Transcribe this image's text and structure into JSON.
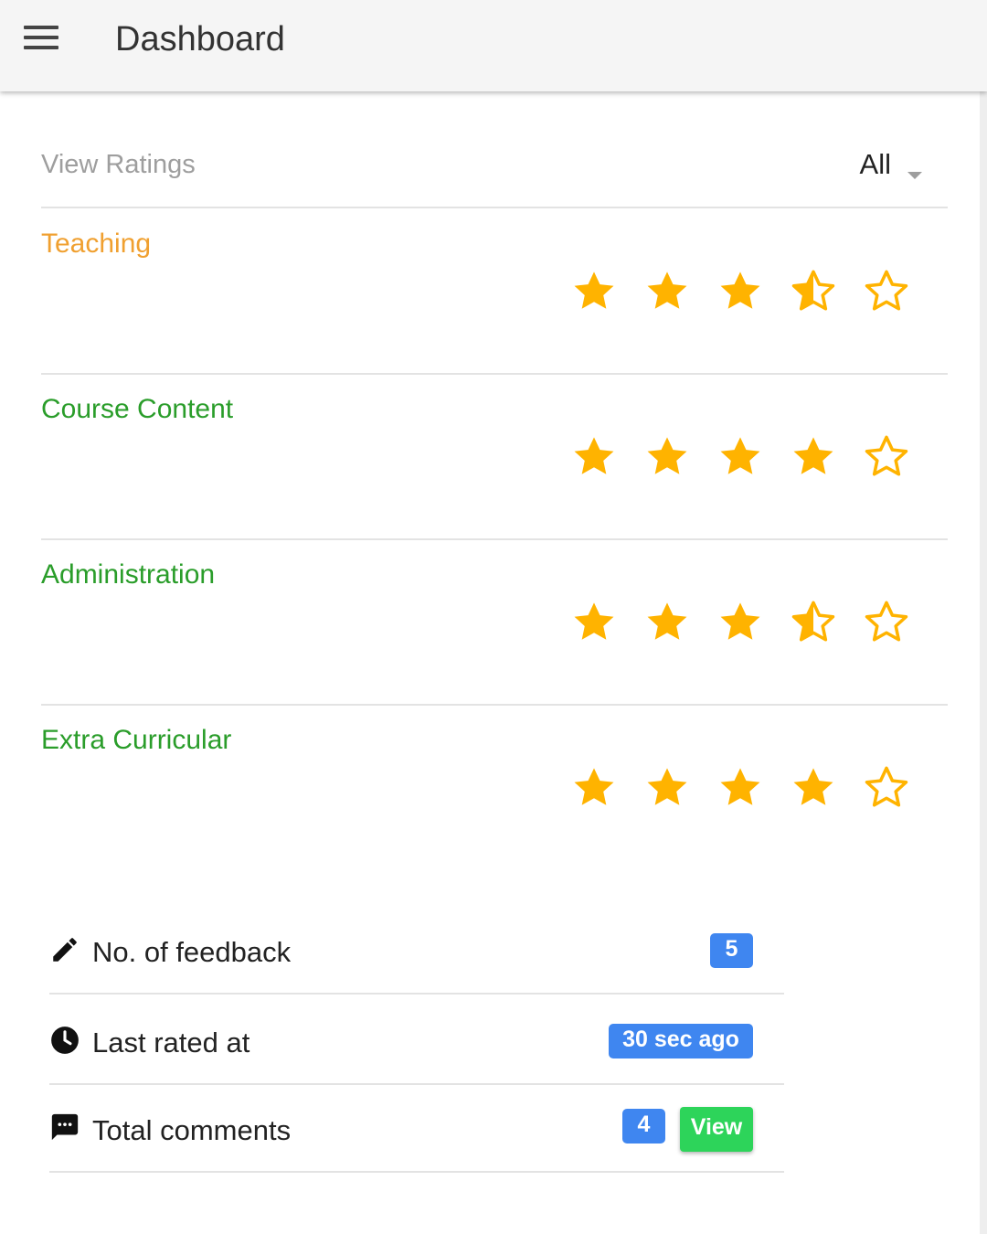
{
  "header": {
    "title": "Dashboard",
    "menu_icon": "hamburger-menu-icon"
  },
  "filter": {
    "label": "View Ratings",
    "selected": "All"
  },
  "ratings": [
    {
      "label": "Teaching",
      "color": "#f0a030",
      "rating": 3.5,
      "max": 5
    },
    {
      "label": "Course Content",
      "color": "#2a9d2a",
      "rating": 4,
      "max": 5
    },
    {
      "label": "Administration",
      "color": "#2a9d2a",
      "rating": 3.5,
      "max": 5
    },
    {
      "label": "Extra Curricular",
      "color": "#2a9d2a",
      "rating": 4,
      "max": 5
    }
  ],
  "star_color": "#ffb300",
  "stats": {
    "feedback": {
      "icon": "pencil-icon",
      "label": "No. of feedback",
      "value": "5"
    },
    "last_rated": {
      "icon": "clock-icon",
      "label": "Last rated at",
      "value": "30 sec ago"
    },
    "comments": {
      "icon": "comment-icon",
      "label": "Total comments",
      "value": "4",
      "action": "View"
    }
  },
  "colors": {
    "badge": "#3f86f0",
    "view_button": "#2dd45a"
  }
}
